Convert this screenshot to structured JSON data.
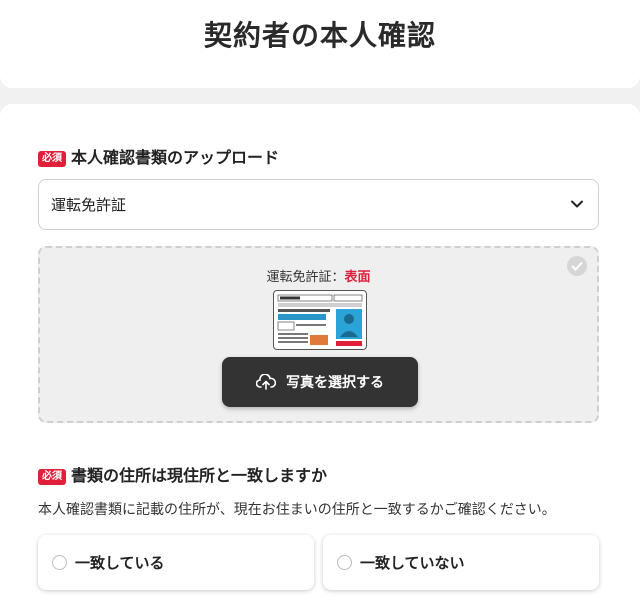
{
  "page_title": "契約者の本人確認",
  "required_badge": "必須",
  "document_upload": {
    "label": "本人確認書類のアップロード",
    "selected_document": "運転免許証",
    "side_caption_prefix": "運転免許証：",
    "side_caption_side": "表面",
    "select_photo_label": "写真を選択する"
  },
  "address_match": {
    "label": "書類の住所は現住所と一致しますか",
    "helper": "本人確認書類に記載の住所が、現在お住まいの住所と一致するかご確認ください。",
    "options": [
      "一致している",
      "一致していない"
    ]
  },
  "colors": {
    "required_red": "#e0203a",
    "button_dark": "#333333"
  }
}
